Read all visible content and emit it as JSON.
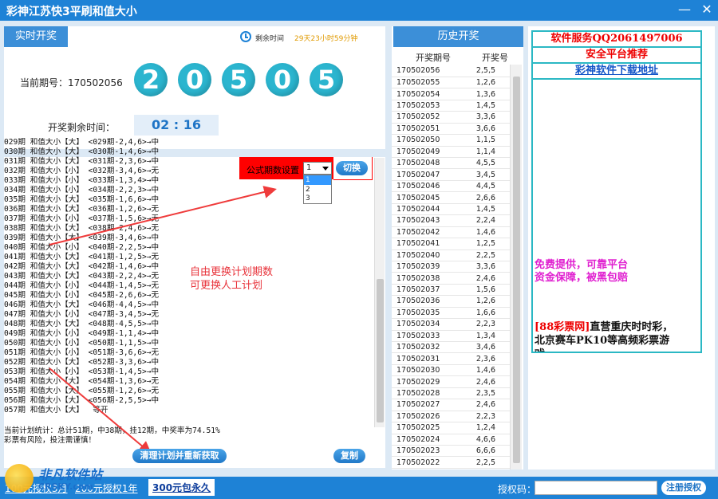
{
  "window": {
    "title": "彩神江苏快3平刷和值大小",
    "minimize": "—",
    "close": "✕"
  },
  "live": {
    "tab": "实时开奖",
    "remaining_label": "剩余时间",
    "remaining_value": "29天23小时59分钟",
    "period_label": "当前期号：170502056",
    "balls": [
      "2",
      "0",
      "5",
      "0",
      "5"
    ],
    "countdown_label": "开奖剩余时间：",
    "countdown_value": "02 : 16"
  },
  "plan": {
    "lines": [
      "029期 和值大小【大】 <029期-2,4,6>→中",
      "030期 和值大小【大】 <030期-1,4,6>→中",
      "031期 和值大小【大】 <031期-2,3,6>→中",
      "032期 和值大小【小】 <032期-3,4,6>→无",
      "033期 和值大小【小】 <033期-1,3,4>→中",
      "034期 和值大小【小】 <034期-2,2,3>→中",
      "035期 和值大小【大】 <035期-1,6,6>→中",
      "036期 和值大小【大】 <036期-1,2,6>→无",
      "037期 和值大小【小】 <037期-1,5,6>→无",
      "038期 和值大小【大】 <038期-2,4,6>→无",
      "039期 和值大小【大】 <039期-3,4,6>→中",
      "040期 和值大小【小】 <040期-2,2,5>→中",
      "041期 和值大小【大】 <041期-1,2,5>→无",
      "042期 和值大小【大】 <042期-1,4,6>→中",
      "043期 和值大小【大】 <043期-2,2,4>→无",
      "044期 和值大小【小】 <044期-1,4,5>→无",
      "045期 和值大小【小】 <045期-2,6,6>→无",
      "046期 和值大小【大】 <046期-4,4,5>→中",
      "047期 和值大小【小】 <047期-3,4,5>→无",
      "048期 和值大小【大】 <048期-4,5,5>→中",
      "049期 和值大小【小】 <049期-1,1,4>→中",
      "050期 和值大小【小】 <050期-1,1,5>→中",
      "051期 和值大小【小】 <051期-3,6,6>→无",
      "052期 和值大小【大】 <052期-3,3,6>→中",
      "053期 和值大小【小】 <053期-1,4,5>→中",
      "054期 和值大小【大】 <054期-1,3,6>→无",
      "055期 和值大小【大】 <055期-1,2,6>→无",
      "056期 和值大小【大】 <056期-2,5,5>→中",
      "057期 和值大小【大】  等开"
    ],
    "summary": "当前计划统计：总计51期，中38期，挂12期，中奖率为74.51%",
    "warning": "彩票有风险，投注需谨慎！",
    "setting_label": "公式期数设置",
    "select_value": "1",
    "options": [
      "1",
      "2",
      "3"
    ],
    "switch_button": "切换",
    "annotation_1": "自由更换计划期数",
    "annotation_2": "可更换人工计划",
    "clear_button": "清理计划并重新获取",
    "copy_button": "复制"
  },
  "history": {
    "tab": "历史开奖",
    "col_period": "开奖期号",
    "col_number": "开奖号",
    "rows": [
      [
        "170502056",
        "2,5,5"
      ],
      [
        "170502055",
        "1,2,6"
      ],
      [
        "170502054",
        "1,3,6"
      ],
      [
        "170502053",
        "1,4,5"
      ],
      [
        "170502052",
        "3,3,6"
      ],
      [
        "170502051",
        "3,6,6"
      ],
      [
        "170502050",
        "1,1,5"
      ],
      [
        "170502049",
        "1,1,4"
      ],
      [
        "170502048",
        "4,5,5"
      ],
      [
        "170502047",
        "3,4,5"
      ],
      [
        "170502046",
        "4,4,5"
      ],
      [
        "170502045",
        "2,6,6"
      ],
      [
        "170502044",
        "1,4,5"
      ],
      [
        "170502043",
        "2,2,4"
      ],
      [
        "170502042",
        "1,4,6"
      ],
      [
        "170502041",
        "1,2,5"
      ],
      [
        "170502040",
        "2,2,5"
      ],
      [
        "170502039",
        "3,3,6"
      ],
      [
        "170502038",
        "2,4,6"
      ],
      [
        "170502037",
        "1,5,6"
      ],
      [
        "170502036",
        "1,2,6"
      ],
      [
        "170502035",
        "1,6,6"
      ],
      [
        "170502034",
        "2,2,3"
      ],
      [
        "170502033",
        "1,3,4"
      ],
      [
        "170502032",
        "3,4,6"
      ],
      [
        "170502031",
        "2,3,6"
      ],
      [
        "170502030",
        "1,4,6"
      ],
      [
        "170502029",
        "2,4,6"
      ],
      [
        "170502028",
        "2,3,5"
      ],
      [
        "170502027",
        "2,4,6"
      ],
      [
        "170502026",
        "2,2,3"
      ],
      [
        "170502025",
        "1,2,4"
      ],
      [
        "170502024",
        "4,6,6"
      ],
      [
        "170502023",
        "6,6,6"
      ],
      [
        "170502022",
        "2,2,5"
      ]
    ]
  },
  "ads": {
    "service": "软件服务QQ2061497006",
    "safe": "安全平台推荐",
    "download": "彩神软件下载地址",
    "free_1": "免费提供，可靠平台",
    "free_2": "资金保障，被黑包赔",
    "promo_prefix": "[88彩票网]",
    "promo_1": "直营重庆时时彩，",
    "promo_2": "北京赛车PK10等高频彩票游",
    "promo_3": "戏"
  },
  "footer": {
    "link_1": "100元授权3月",
    "link_2": "200元授权1年",
    "link_3": "300元包永久",
    "auth_label": "授权码：",
    "register_button": "注册授权",
    "watermark_cn": "非凡软件站",
    "watermark_en": "CRSKY.com"
  },
  "colors": {
    "accent": "#1e82d6",
    "ball": "#2bb5cf",
    "red": "#ff0000",
    "teal_border": "#2bb8c4"
  }
}
